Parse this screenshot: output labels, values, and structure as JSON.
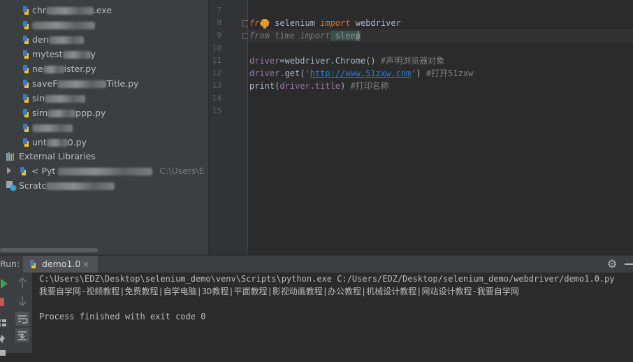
{
  "project_tree": {
    "files": [
      {
        "visible": "chr",
        "tail": ".exe"
      },
      {
        "visible": "",
        "tail": ""
      },
      {
        "visible": "den",
        "tail": ""
      },
      {
        "visible": "mytest",
        "tail": "y"
      },
      {
        "visible": "ne",
        "tail": "ister.py"
      },
      {
        "visible": "saveF",
        "tail": "Title.py"
      },
      {
        "visible": "sin",
        "tail": ""
      },
      {
        "visible": "sim",
        "tail": "ppp.py"
      },
      {
        "visible": "",
        "tail": ""
      },
      {
        "visible": "unt",
        "tail": "0.py"
      }
    ],
    "external_libraries": "External Libraries",
    "python_sdk_prefix": "< Pyt",
    "python_sdk_path": "C:\\Users\\E",
    "scratches_prefix": "Scratc"
  },
  "editor": {
    "line_numbers": [
      "7",
      "8",
      "9",
      "10",
      "11",
      "12",
      "13",
      "14",
      "15"
    ],
    "lines": {
      "l8": {
        "kw_from": "from",
        "module": " selenium ",
        "kw_import": "import",
        "name": " webdriver"
      },
      "l9": {
        "kw_from": "from",
        "module": " time ",
        "kw_import": "import",
        "name": " sleep"
      },
      "l11": {
        "lhs": "driver",
        "eq": "=",
        "obj": "webdriver.",
        "call": "Chrome",
        "paren": "() ",
        "comment": "#声明浏览器对象"
      },
      "l12": {
        "obj": "driver.",
        "call": "get",
        "open": "(",
        "q1": "'",
        "url": "http://www.51zxw.com",
        "q2": "'",
        "close": ") ",
        "comment": "#打开51zxw"
      },
      "l13": {
        "call": "print",
        "open": "(",
        "arg": "driver.title",
        "close": ") ",
        "comment": "#打印名称"
      }
    }
  },
  "run_panel": {
    "label": "Run:",
    "tab_name": "demo1.0",
    "tab_close": "×",
    "gear": "⚙",
    "console": [
      "C:\\Users\\EDZ\\Desktop\\selenium_demo\\venv\\Scripts\\python.exe C:/Users/EDZ/Desktop/selenium_demo/webdriver/demo1.0.py",
      "我要自学网-视频教程|免费教程|自学电脑|3D教程|平面教程|影视动画教程|办公教程|机械设计教程|网站设计教程-我要自学网",
      "",
      "Process finished with exit code 0"
    ]
  },
  "colors": {
    "background": "#2b2b2b",
    "panel": "#3c3f41",
    "keyword": "#cc7832",
    "function": "#ffc66d",
    "string": "#6a8759",
    "url": "#287bde",
    "comment": "#808080",
    "run_green": "#499c54"
  },
  "icons": {
    "python_file": "python-file-icon",
    "library": "library-icon",
    "scratches": "scratches-icon",
    "run": "run-icon",
    "gear": "gear-icon"
  }
}
